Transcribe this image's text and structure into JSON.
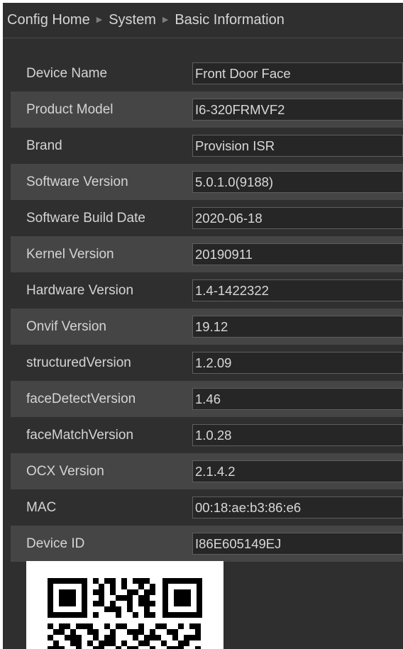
{
  "breadcrumb": {
    "items": [
      "Config Home",
      "System",
      "Basic Information"
    ]
  },
  "info_rows": [
    {
      "label": "Device Name",
      "value": "Front Door Face"
    },
    {
      "label": "Product Model",
      "value": "I6-320FRMVF2"
    },
    {
      "label": "Brand",
      "value": "Provision ISR"
    },
    {
      "label": "Software Version",
      "value": "5.0.1.0(9188)"
    },
    {
      "label": "Software Build Date",
      "value": "2020-06-18"
    },
    {
      "label": "Kernel Version",
      "value": "20190911"
    },
    {
      "label": "Hardware Version",
      "value": "1.4-1422322"
    },
    {
      "label": "Onvif Version",
      "value": "19.12"
    },
    {
      "label": "structuredVersion",
      "value": "1.2.09"
    },
    {
      "label": "faceDetectVersion",
      "value": "1.46"
    },
    {
      "label": "faceMatchVersion",
      "value": "1.0.28"
    },
    {
      "label": "OCX Version",
      "value": "2.1.4.2"
    },
    {
      "label": "MAC",
      "value": "00:18:ae:b3:86:e6"
    },
    {
      "label": "Device ID",
      "value": "I86E605149EJ"
    }
  ],
  "colors": {
    "panel_bg": "#2f2f2f",
    "row_alt_bg": "#454545",
    "field_bg": "#262626",
    "field_border": "#5e5e5e",
    "text": "#d4d4d4"
  },
  "icons": {
    "breadcrumb_separator": "triangle-right-icon",
    "qr": "qr-code-icon"
  }
}
